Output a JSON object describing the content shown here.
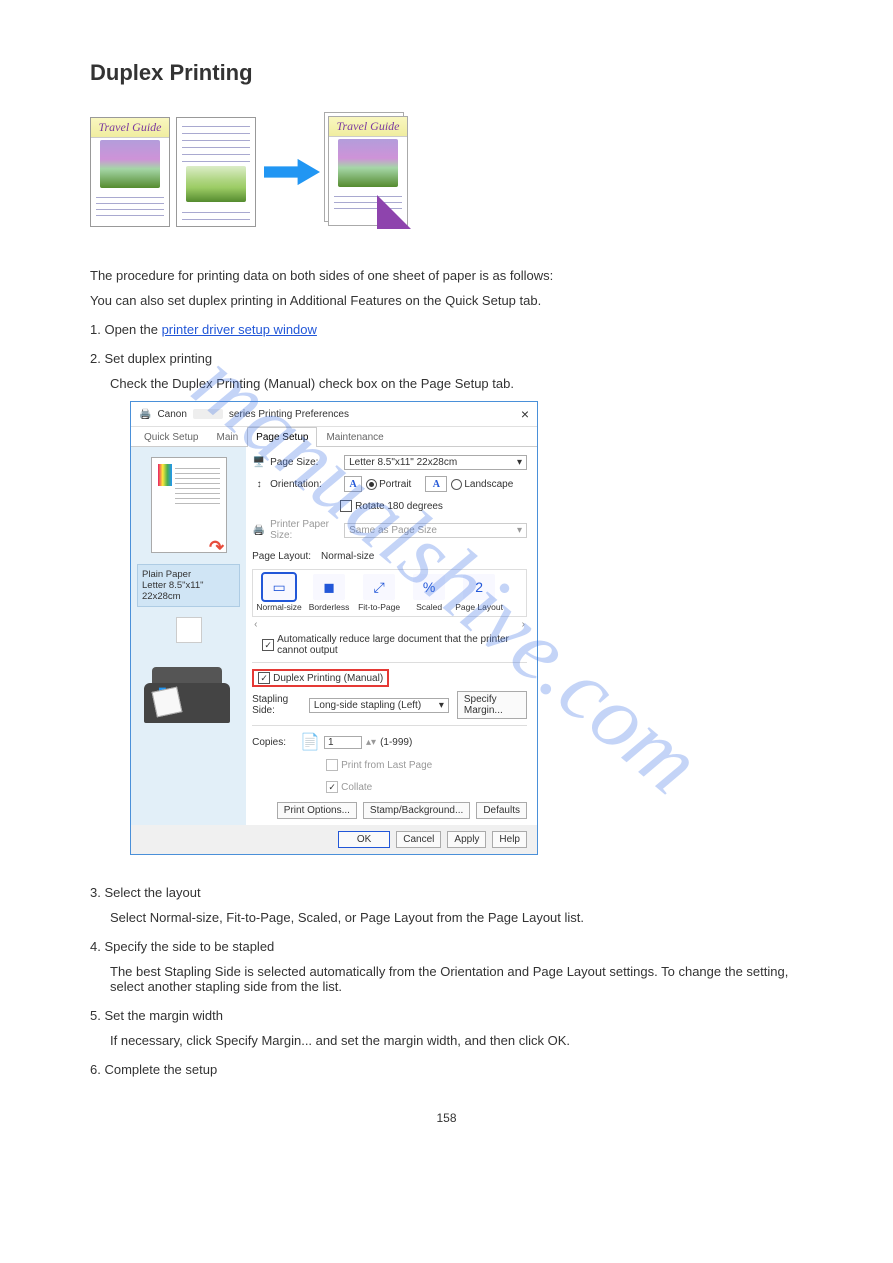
{
  "page": {
    "title": "Duplex Printing",
    "illustration_caption": "Travel Guide",
    "procedure_intro": "The procedure for printing data on both sides of one sheet of paper is as follows:",
    "also_set_hint": "You can also set duplex printing in Additional Features on the Quick Setup tab.",
    "step1_title": "1. Open the printer driver setup window",
    "link_text": "printer driver setup window",
    "step2_title": "2. Set duplex printing",
    "step2_body": "Check the Duplex Printing (Manual) check box on the Page Setup tab.",
    "step3_title": "3. Select the layout",
    "step3_body": "Select Normal-size, Fit-to-Page, Scaled, or Page Layout from the Page Layout list.",
    "step4_title": "4. Specify the side to be stapled",
    "step4_body": "The best Stapling Side is selected automatically from the Orientation and Page Layout settings. To change the setting, select another stapling side from the list.",
    "step5_title": "5. Set the margin width",
    "step5_body": "If necessary, click Specify Margin... and set the margin width, and then click OK.",
    "step6_title": "6. Complete the setup"
  },
  "dialog": {
    "title_prefix": "Canon",
    "title_suffix": "series Printing Preferences",
    "tabs": [
      "Quick Setup",
      "Main",
      "Page Setup",
      "Maintenance"
    ],
    "preview": {
      "paper_type": "Plain Paper",
      "paper_size": "Letter 8.5\"x11\" 22x28cm"
    },
    "page_size_label": "Page Size:",
    "page_size_value": "Letter 8.5\"x11\" 22x28cm",
    "orientation_label": "Orientation:",
    "orientation_portrait": "Portrait",
    "orientation_landscape": "Landscape",
    "rotate_180": "Rotate 180 degrees",
    "printer_paper_label": "Printer Paper Size:",
    "printer_paper_value": "Same as Page Size",
    "page_layout_label": "Page Layout:",
    "page_layout_value": "Normal-size",
    "layout_items": [
      "Normal-size",
      "Borderless",
      "Fit-to-Page",
      "Scaled",
      "Page Layout"
    ],
    "auto_reduce": "Automatically reduce large document that the printer cannot output",
    "duplex_checkbox": "Duplex Printing (Manual)",
    "stapling_label": "Stapling Side:",
    "stapling_value": "Long-side stapling (Left)",
    "specify_margin": "Specify Margin...",
    "copies_label": "Copies:",
    "copies_value": "1",
    "copies_range": "(1-999)",
    "print_last": "Print from Last Page",
    "collate": "Collate",
    "print_options": "Print Options...",
    "stamp_background": "Stamp/Background...",
    "defaults": "Defaults",
    "ok": "OK",
    "cancel": "Cancel",
    "apply": "Apply",
    "help": "Help"
  },
  "watermark": "manualshive.com",
  "page_number": "158"
}
